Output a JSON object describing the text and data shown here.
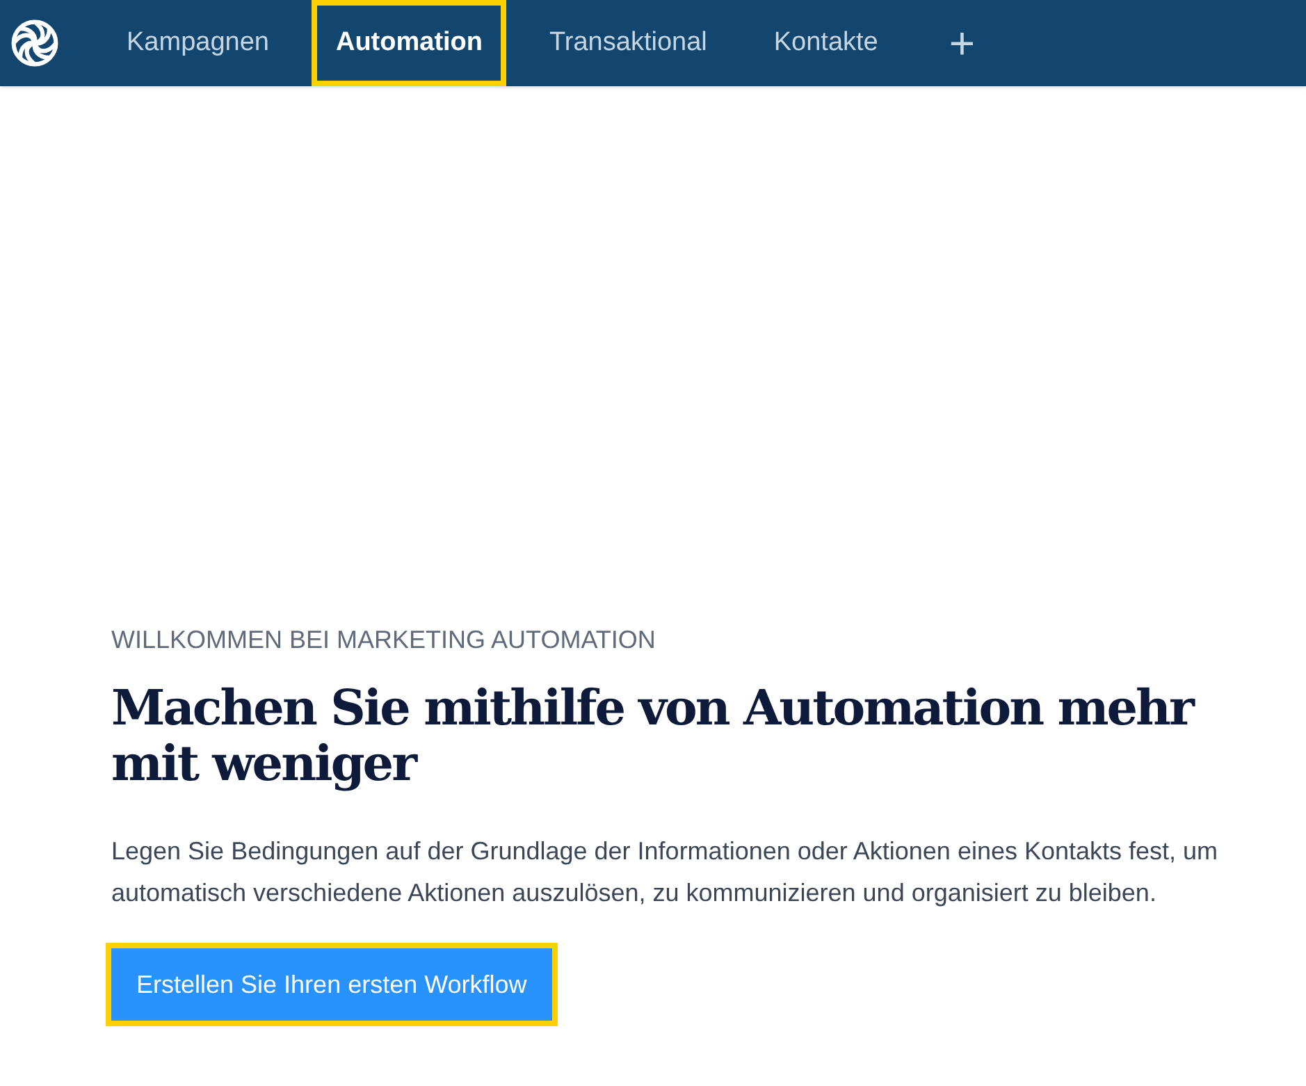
{
  "nav": {
    "tabs": [
      {
        "label": "Kampagnen",
        "selected": false,
        "highlighted": false
      },
      {
        "label": "Automation",
        "selected": true,
        "highlighted": true
      },
      {
        "label": "Transaktional",
        "selected": false,
        "highlighted": false
      },
      {
        "label": "Kontakte",
        "selected": false,
        "highlighted": false
      }
    ],
    "add_label": "+"
  },
  "welcome": {
    "eyebrow": "WILLKOMMEN BEI MARKETING AUTOMATION",
    "heading": "Machen Sie mithilfe von Automation mehr mit weniger",
    "body": "Legen Sie Bedingungen auf der Grundlage der Informationen oder Aktionen eines Kontakts fest, um automatisch verschiedene Aktionen auszulösen, zu kommunizieren und organisiert zu bleiben.",
    "button": {
      "label": "Erstellen Sie Ihren ersten Workflow",
      "highlighted": true
    }
  }
}
